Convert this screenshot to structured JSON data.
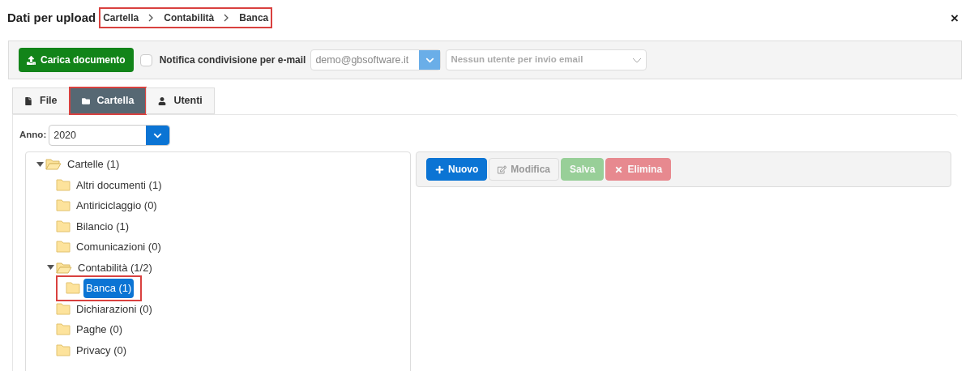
{
  "dialog": {
    "title": "Dati per upload",
    "close": "×"
  },
  "breadcrumb": {
    "highlighted": true,
    "items": [
      "Cartella",
      "Contabilità",
      "Banca"
    ]
  },
  "toolbar": {
    "upload_button": "Carica documento",
    "notify": {
      "label": "Notifica condivisione per e-mail",
      "checked": false
    },
    "sender": {
      "value": "demo@gbsoftware.it"
    },
    "recipients": {
      "placeholder": "Nessun utente per invio email"
    }
  },
  "tabs": [
    {
      "label": "File",
      "kind": "file",
      "selected": false,
      "highlighted": false
    },
    {
      "label": "Cartella",
      "kind": "folder",
      "selected": true,
      "highlighted": true
    },
    {
      "label": "Utenti",
      "kind": "user",
      "selected": false,
      "highlighted": false
    }
  ],
  "year": {
    "label": "Anno:",
    "value": "2020"
  },
  "tree": [
    {
      "label": "Cartelle (1)",
      "expanded": true,
      "selected": false,
      "highlighted": false,
      "children": [
        {
          "label": "Altri documenti (1)",
          "selected": false,
          "highlighted": false
        },
        {
          "label": "Antiriciclaggio (0)",
          "selected": false,
          "highlighted": false
        },
        {
          "label": "Bilancio (1)",
          "selected": false,
          "highlighted": false
        },
        {
          "label": "Comunicazioni (0)",
          "selected": false,
          "highlighted": false
        },
        {
          "label": "Contabilità (1/2)",
          "expanded": true,
          "selected": false,
          "highlighted": false,
          "children": [
            {
              "label": "Banca (1)",
              "selected": true,
              "highlighted": true
            }
          ]
        },
        {
          "label": "Dichiarazioni (0)",
          "selected": false,
          "highlighted": false
        },
        {
          "label": "Paghe (0)",
          "selected": false,
          "highlighted": false
        },
        {
          "label": "Privacy (0)",
          "selected": false,
          "highlighted": false
        }
      ]
    }
  ],
  "actions": [
    {
      "kind": "new",
      "label": "Nuovo",
      "disabled": false
    },
    {
      "kind": "edit",
      "label": "Modifica",
      "disabled": true
    },
    {
      "kind": "save",
      "label": "Salva",
      "disabled": true
    },
    {
      "kind": "delete",
      "label": "Elimina",
      "disabled": true
    }
  ]
}
